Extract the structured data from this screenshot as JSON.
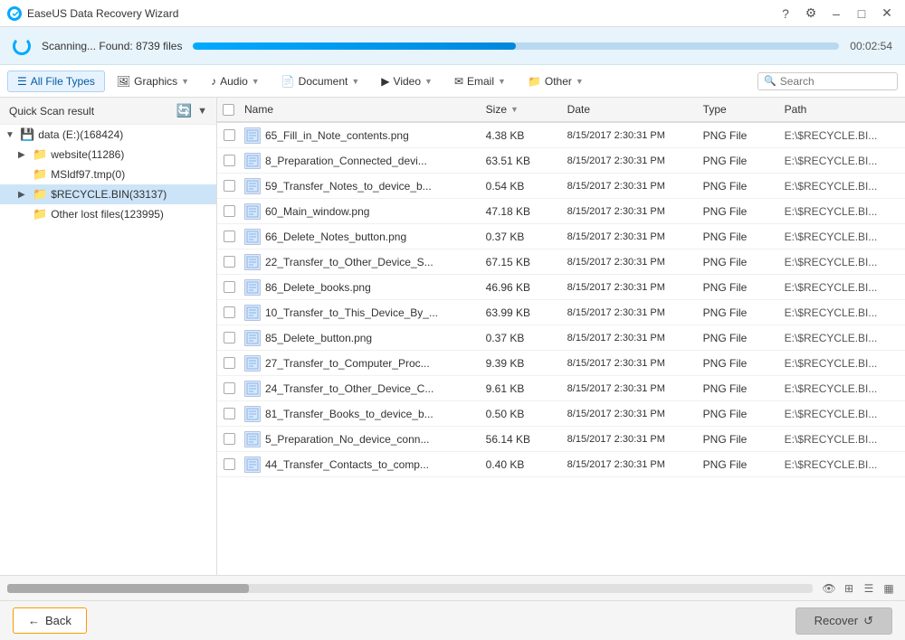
{
  "titleBar": {
    "title": "EaseUS Data Recovery Wizard",
    "minimizeLabel": "–",
    "maximizeLabel": "□",
    "closeLabel": "✕",
    "helpLabel": "?",
    "settingsLabel": "⚙"
  },
  "progress": {
    "text": "Scanning... Found: 8739 files",
    "time": "00:02:54",
    "percent": 50
  },
  "tabs": [
    {
      "id": "all",
      "label": "All File Types",
      "icon": "☰",
      "active": true,
      "hasArrow": false
    },
    {
      "id": "graphics",
      "label": "Graphics",
      "icon": "🖼",
      "active": false,
      "hasArrow": true
    },
    {
      "id": "audio",
      "label": "Audio",
      "icon": "♪",
      "active": false,
      "hasArrow": true
    },
    {
      "id": "document",
      "label": "Document",
      "icon": "📄",
      "active": false,
      "hasArrow": true
    },
    {
      "id": "video",
      "label": "Video",
      "icon": "▶",
      "active": false,
      "hasArrow": true
    },
    {
      "id": "email",
      "label": "Email",
      "icon": "✉",
      "active": false,
      "hasArrow": true
    },
    {
      "id": "other",
      "label": "Other",
      "icon": "📁",
      "active": false,
      "hasArrow": true
    }
  ],
  "search": {
    "placeholder": "Search"
  },
  "sidebar": {
    "title": "Quick Scan result",
    "items": [
      {
        "id": "data-drive",
        "label": "data (E:)(168424)",
        "indent": 0,
        "type": "drive",
        "expanded": true
      },
      {
        "id": "website",
        "label": "website(11286)",
        "indent": 1,
        "type": "folder",
        "expanded": false
      },
      {
        "id": "msldf97",
        "label": "MSldf97.tmp(0)",
        "indent": 1,
        "type": "folder",
        "expanded": false
      },
      {
        "id": "recycle-bin",
        "label": "$RECYCLE.BIN(33137)",
        "indent": 1,
        "type": "folder",
        "expanded": false,
        "selected": true
      },
      {
        "id": "other-lost",
        "label": "Other lost files(123995)",
        "indent": 1,
        "type": "folder",
        "expanded": false
      }
    ]
  },
  "fileList": {
    "columns": [
      {
        "id": "name",
        "label": "Name",
        "hasSortArrow": false
      },
      {
        "id": "size",
        "label": "Size",
        "hasSortArrow": true
      },
      {
        "id": "date",
        "label": "Date",
        "hasSortArrow": false
      },
      {
        "id": "type",
        "label": "Type",
        "hasSortArrow": false
      },
      {
        "id": "path",
        "label": "Path",
        "hasSortArrow": false
      }
    ],
    "files": [
      {
        "name": "65_Fill_in_Note_contents.png",
        "size": "4.38 KB",
        "date": "8/15/2017 2:30:31 PM",
        "type": "PNG File",
        "path": "E:\\$RECYCLE.BI..."
      },
      {
        "name": "8_Preparation_Connected_devi...",
        "size": "63.51 KB",
        "date": "8/15/2017 2:30:31 PM",
        "type": "PNG File",
        "path": "E:\\$RECYCLE.BI..."
      },
      {
        "name": "59_Transfer_Notes_to_device_b...",
        "size": "0.54 KB",
        "date": "8/15/2017 2:30:31 PM",
        "type": "PNG File",
        "path": "E:\\$RECYCLE.BI..."
      },
      {
        "name": "60_Main_window.png",
        "size": "47.18 KB",
        "date": "8/15/2017 2:30:31 PM",
        "type": "PNG File",
        "path": "E:\\$RECYCLE.BI..."
      },
      {
        "name": "66_Delete_Notes_button.png",
        "size": "0.37 KB",
        "date": "8/15/2017 2:30:31 PM",
        "type": "PNG File",
        "path": "E:\\$RECYCLE.BI..."
      },
      {
        "name": "22_Transfer_to_Other_Device_S...",
        "size": "67.15 KB",
        "date": "8/15/2017 2:30:31 PM",
        "type": "PNG File",
        "path": "E:\\$RECYCLE.BI..."
      },
      {
        "name": "86_Delete_books.png",
        "size": "46.96 KB",
        "date": "8/15/2017 2:30:31 PM",
        "type": "PNG File",
        "path": "E:\\$RECYCLE.BI..."
      },
      {
        "name": "10_Transfer_to_This_Device_By_...",
        "size": "63.99 KB",
        "date": "8/15/2017 2:30:31 PM",
        "type": "PNG File",
        "path": "E:\\$RECYCLE.BI..."
      },
      {
        "name": "85_Delete_button.png",
        "size": "0.37 KB",
        "date": "8/15/2017 2:30:31 PM",
        "type": "PNG File",
        "path": "E:\\$RECYCLE.BI..."
      },
      {
        "name": "27_Transfer_to_Computer_Proc...",
        "size": "9.39 KB",
        "date": "8/15/2017 2:30:31 PM",
        "type": "PNG File",
        "path": "E:\\$RECYCLE.BI..."
      },
      {
        "name": "24_Transfer_to_Other_Device_C...",
        "size": "9.61 KB",
        "date": "8/15/2017 2:30:31 PM",
        "type": "PNG File",
        "path": "E:\\$RECYCLE.BI..."
      },
      {
        "name": "81_Transfer_Books_to_device_b...",
        "size": "0.50 KB",
        "date": "8/15/2017 2:30:31 PM",
        "type": "PNG File",
        "path": "E:\\$RECYCLE.BI..."
      },
      {
        "name": "5_Preparation_No_device_conn...",
        "size": "56.14 KB",
        "date": "8/15/2017 2:30:31 PM",
        "type": "PNG File",
        "path": "E:\\$RECYCLE.BI..."
      },
      {
        "name": "44_Transfer_Contacts_to_comp...",
        "size": "0.40 KB",
        "date": "8/15/2017 2:30:31 PM",
        "type": "PNG File",
        "path": "E:\\$RECYCLE.BI..."
      }
    ]
  },
  "footer": {
    "backLabel": "Back",
    "recoverLabel": "Recover"
  }
}
